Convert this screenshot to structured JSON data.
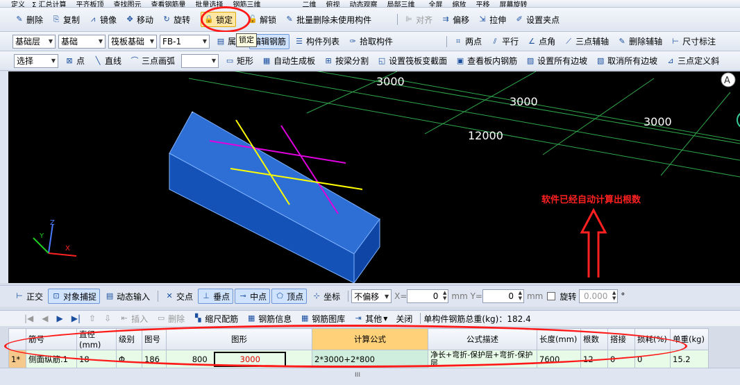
{
  "menu": {
    "items": [
      "定义",
      "Σ 汇总计算",
      "平齐板顶",
      "查找图元",
      "查看钢筋量",
      "批量选择",
      "钢筋三维",
      "二维",
      "俯视",
      "动态观察",
      "局部三维",
      "全屏",
      "缩放",
      "平移",
      "屏幕旋转"
    ]
  },
  "toolbar1": {
    "items": [
      "删除",
      "复制",
      "镜像",
      "移动",
      "旋转",
      "锁定",
      "解锁",
      "批量删除未使用构件",
      "对齐",
      "偏移",
      "拉伸",
      "设置夹点"
    ],
    "tooltip": "锁定"
  },
  "toolbar2": {
    "floor": "基础层",
    "category": "基础",
    "type": "筏板基础",
    "member": "FB-1",
    "items": [
      "属性",
      "编辑钢筋",
      "构件列表",
      "拾取构件",
      "两点",
      "平行",
      "点角",
      "三点辅轴",
      "删除辅轴",
      "尺寸标注"
    ]
  },
  "toolbar3": {
    "select": "选择",
    "items": [
      "点",
      "直线",
      "三点画弧",
      "矩形",
      "自动生成板",
      "按梁分割",
      "设置筏板变截面",
      "查看板内钢筋",
      "设置所有边坡",
      "取消所有边坡",
      "三点定义斜"
    ]
  },
  "viewport": {
    "dims": [
      "3000",
      "3000",
      "3000",
      "12000"
    ],
    "axis_labels": [
      "Z",
      "Y",
      "X"
    ],
    "compass": "A",
    "annotation": "软件已经自动计算出根数"
  },
  "snapbar": {
    "items": [
      "正交",
      "对象捕捉",
      "动态输入",
      "交点",
      "垂点",
      "中点",
      "顶点",
      "坐标"
    ],
    "offset_mode": "不偏移",
    "x_label": "X=",
    "x_value": "0",
    "y_label": "mm Y=",
    "y_value": "0",
    "unit": "mm",
    "rotate_label": "旋转",
    "rotate_value": "0.000",
    "degree": "°"
  },
  "gridtoolbar": {
    "items": [
      "插入",
      "删除",
      "缩尺配筋",
      "钢筋信息",
      "钢筋图库",
      "其他",
      "关闭"
    ],
    "total_weight": "单构件钢筋总重(kg)：182.4"
  },
  "grid": {
    "headers": [
      "筋号",
      "直径(mm)",
      "级别",
      "图号",
      "图形",
      "计算公式",
      "公式描述",
      "长度(mm)",
      "根数",
      "搭接",
      "损耗(%)",
      "单重(kg)"
    ],
    "rows": [
      {
        "num": "1*",
        "name": "侧面纵筋.1",
        "diameter": "18",
        "grade": "Φ",
        "figure_no": "186",
        "shape_left": "800",
        "shape_value": "3000",
        "formula": "2*3000+2*800",
        "description": "净长+弯折-保护层+弯折-保护层",
        "length": "7600",
        "count": "12",
        "lap": "0",
        "loss": "0",
        "unit_weight": "15.2"
      }
    ]
  },
  "colors": {
    "viewport_bg": "#000000",
    "slab_top": "#2e6fd6",
    "slab_side": "#1552b8",
    "grid_line": "#2fa84a",
    "annotation": "#ff2020",
    "highlight": "#ff1a1a"
  }
}
